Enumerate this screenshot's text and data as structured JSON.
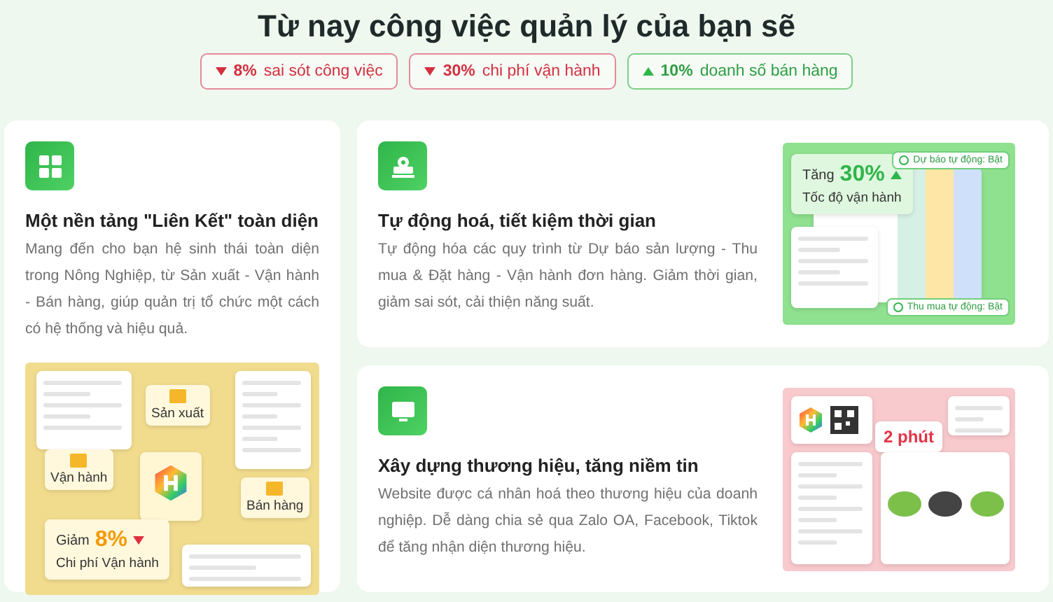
{
  "heading": "Từ nay công việc quản lý của bạn sẽ",
  "badges": [
    {
      "value": "8%",
      "label": "sai sót công việc",
      "rising": false
    },
    {
      "value": "30%",
      "label": "chi phí vận hành",
      "rising": false
    },
    {
      "value": "10%",
      "label": "doanh số bán hàng",
      "rising": true
    }
  ],
  "cards": [
    {
      "kind": "tall",
      "title": "Một nền tảng \"Liên Kết\" toàn diện",
      "description": "Mang đến cho bạn hệ sinh thái toàn diện trong Nông Nghiệp, từ Sản xuất - Vận hành - Bán hàng, giúp quản trị tổ chức một cách có hệ thống và hiệu quả.",
      "illustration": {
        "kind": "hub",
        "nodes": [
          "Sản xuất",
          "Vận hành",
          "Bán hàng"
        ],
        "stat": {
          "prefix": "Giảm",
          "value": "8%",
          "rising": false,
          "caption": "Chi phí Vận hành"
        }
      }
    },
    {
      "kind": "wide",
      "title": "Tự động hoá, tiết kiệm thời gian",
      "description": "Tự động hóa các quy trình từ Dự báo sản lượng - Thu mua & Đặt hàng - Vận hành đơn hàng. Giảm thời gian, giảm sai sót, cải thiện năng suất.",
      "illustration": {
        "kind": "automation",
        "stat": {
          "prefix": "Tăng",
          "value": "30%",
          "rising": true,
          "caption": "Tốc độ vận hành"
        },
        "toggles": [
          "Dự báo tự động: Bật",
          "Thu mua tự động: Bật"
        ]
      }
    },
    {
      "kind": "wide",
      "title": "Xây dựng thương hiệu, tăng niềm tin",
      "description": "Website được cá nhân hoá theo thương hiệu của doanh nghiệp. Dễ dàng chia sẻ qua Zalo OA, Facebook, Tiktok để tăng nhận diện thương hiệu.",
      "illustration": {
        "kind": "website",
        "highlight": "2 phút"
      }
    }
  ]
}
